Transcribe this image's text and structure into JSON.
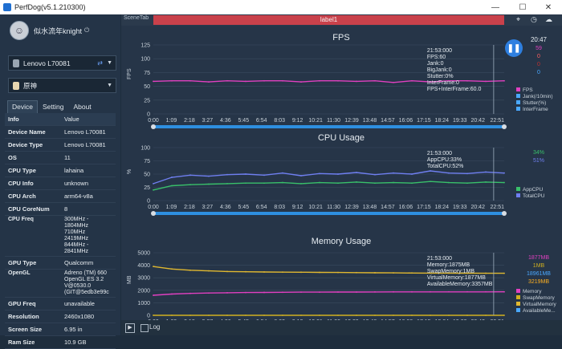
{
  "window": {
    "title": "PerfDog(v5.1.210300)",
    "minimize": "—",
    "maximize": "☐",
    "close": "✕"
  },
  "user": {
    "name": "似水流年knight",
    "power_icon": "⏻"
  },
  "device_selector": {
    "value": "Lenovo L70081"
  },
  "app_selector": {
    "value": "原神"
  },
  "tabs": [
    "Device",
    "Setting",
    "About"
  ],
  "info": {
    "header": {
      "k": "Info",
      "v": "Value"
    },
    "rows": [
      {
        "k": "Device Name",
        "v": "Lenovo L70081"
      },
      {
        "k": "Device Type",
        "v": "Lenovo L70081"
      },
      {
        "k": "OS",
        "v": "11"
      },
      {
        "k": "CPU Type",
        "v": "lahaina"
      },
      {
        "k": "CPU Info",
        "v": "unknown"
      },
      {
        "k": "CPU Arch",
        "v": "arm64-v8a"
      },
      {
        "k": "CPU CoreNum",
        "v": "8"
      }
    ],
    "cpu_freq": {
      "k": "CPU Freq",
      "lines": [
        "300MHz -",
        "1804MHz",
        "710MHz",
        "2419MHz",
        "844MHz -",
        "2841MHz"
      ]
    },
    "gpu_type": {
      "k": "GPU Type",
      "v": "Qualcomm"
    },
    "opengl": {
      "k": "OpenGL",
      "lines": [
        "Adreno (TM) 660",
        "OpenGL ES 3.2",
        "V@0530.0",
        "(GIT@5edb3e99c"
      ]
    },
    "rows2": [
      {
        "k": "GPU Freq",
        "v": "unavailable"
      },
      {
        "k": "Resolution",
        "v": "2460x1080"
      },
      {
        "k": "Screen Size",
        "v": "6.95 in"
      },
      {
        "k": "Ram Size",
        "v": "10.9 GB"
      }
    ]
  },
  "topbar": {
    "scene_tab": "SceneTab",
    "label": "label1"
  },
  "time_axis": [
    "0:00",
    "1:09",
    "2:18",
    "3:27",
    "4:36",
    "5:45",
    "6:54",
    "8:03",
    "9:12",
    "10:21",
    "11:30",
    "12:39",
    "13:48",
    "14:57",
    "16:06",
    "17:15",
    "18:24",
    "19:33",
    "20:42"
  ],
  "chart_data": [
    {
      "type": "line",
      "title": "FPS",
      "ylabel": "FPS",
      "ylim": [
        0,
        125
      ],
      "yticks": [
        0,
        25,
        50,
        75,
        100,
        125
      ],
      "end_time": "22:51",
      "tooltip": [
        "21:53:000",
        "FPS:60",
        "Jank:0",
        "BigJank:0",
        "Stutter:0%",
        "InterFrame:0",
        "FPS+InterFrame:60.0"
      ],
      "right_values": {
        "time": "20:47",
        "values": [
          "59",
          "0",
          "0",
          "0"
        ],
        "colors": [
          "#e040c0",
          "#ff6060",
          "#c03030",
          "#4aa8ff"
        ]
      },
      "legend": [
        "FPS",
        "Jank(/10min)",
        "Stutter(%)",
        "InterFrame"
      ],
      "series": [
        {
          "name": "FPS",
          "values": [
            59,
            60,
            60,
            58,
            60,
            59,
            60,
            60,
            58,
            60,
            60,
            59,
            60,
            57,
            60,
            58,
            60,
            60,
            59,
            60
          ]
        }
      ]
    },
    {
      "type": "line",
      "title": "CPU Usage",
      "ylabel": "%",
      "ylim": [
        0,
        100
      ],
      "yticks": [
        0,
        25,
        50,
        75,
        100
      ],
      "end_time": "22:51",
      "tooltip": [
        "21:53:000",
        "AppCPU:33%",
        "TotalCPU:52%"
      ],
      "right_values": {
        "values": [
          "34%",
          "51%"
        ],
        "colors": [
          "#39c06a",
          "#6f7ff0"
        ]
      },
      "legend": [
        "AppCPU",
        "TotalCPU"
      ],
      "series": [
        {
          "name": "AppCPU",
          "values": [
            20,
            28,
            30,
            31,
            32,
            33,
            33,
            34,
            32,
            34,
            33,
            35,
            33,
            34,
            33,
            36,
            34,
            33,
            35,
            34
          ]
        },
        {
          "name": "TotalCPU",
          "values": [
            32,
            44,
            48,
            46,
            49,
            50,
            48,
            52,
            47,
            51,
            50,
            53,
            49,
            52,
            50,
            56,
            52,
            51,
            54,
            52
          ]
        }
      ]
    },
    {
      "type": "line",
      "title": "Memory Usage",
      "ylabel": "MB",
      "ylim": [
        0,
        5000
      ],
      "yticks": [
        0,
        1000,
        2000,
        3000,
        4000,
        5000
      ],
      "end_time": "22:51",
      "tooltip": [
        "21:53:000",
        "Memory:1875MB",
        "SwapMemory:1MB",
        "VirtualMemory:1877MB",
        "AvailableMemory:3357MB"
      ],
      "right_values": {
        "values": [
          "1877MB",
          "1MB",
          "18961MB",
          "3219MB"
        ],
        "colors": [
          "#e040c0",
          "#d0b020",
          "#4aa8ff",
          "#ffb020"
        ]
      },
      "legend": [
        "Memory",
        "SwapMemory",
        "VirtualMemory",
        "AvailableMe..."
      ],
      "series": [
        {
          "name": "Memory",
          "values": [
            1600,
            1700,
            1750,
            1780,
            1800,
            1820,
            1830,
            1840,
            1850,
            1850,
            1860,
            1860,
            1865,
            1870,
            1870,
            1872,
            1874,
            1875,
            1875,
            1877
          ]
        },
        {
          "name": "SwapMemory",
          "values": [
            1,
            1,
            1,
            1,
            1,
            1,
            1,
            1,
            1,
            1,
            1,
            1,
            1,
            1,
            1,
            1,
            1,
            1,
            1,
            1
          ]
        },
        {
          "name": "AvailableMemory",
          "values": [
            3900,
            3700,
            3600,
            3550,
            3500,
            3480,
            3460,
            3450,
            3440,
            3430,
            3420,
            3410,
            3400,
            3390,
            3380,
            3375,
            3370,
            3365,
            3360,
            3357
          ]
        }
      ]
    }
  ],
  "bottom": {
    "log_label": "Log",
    "play_icon": "▶"
  },
  "icons": {
    "location": "location-icon",
    "stopwatch": "stopwatch-icon",
    "cloud": "cloud-icon",
    "pause": "pause-icon"
  }
}
